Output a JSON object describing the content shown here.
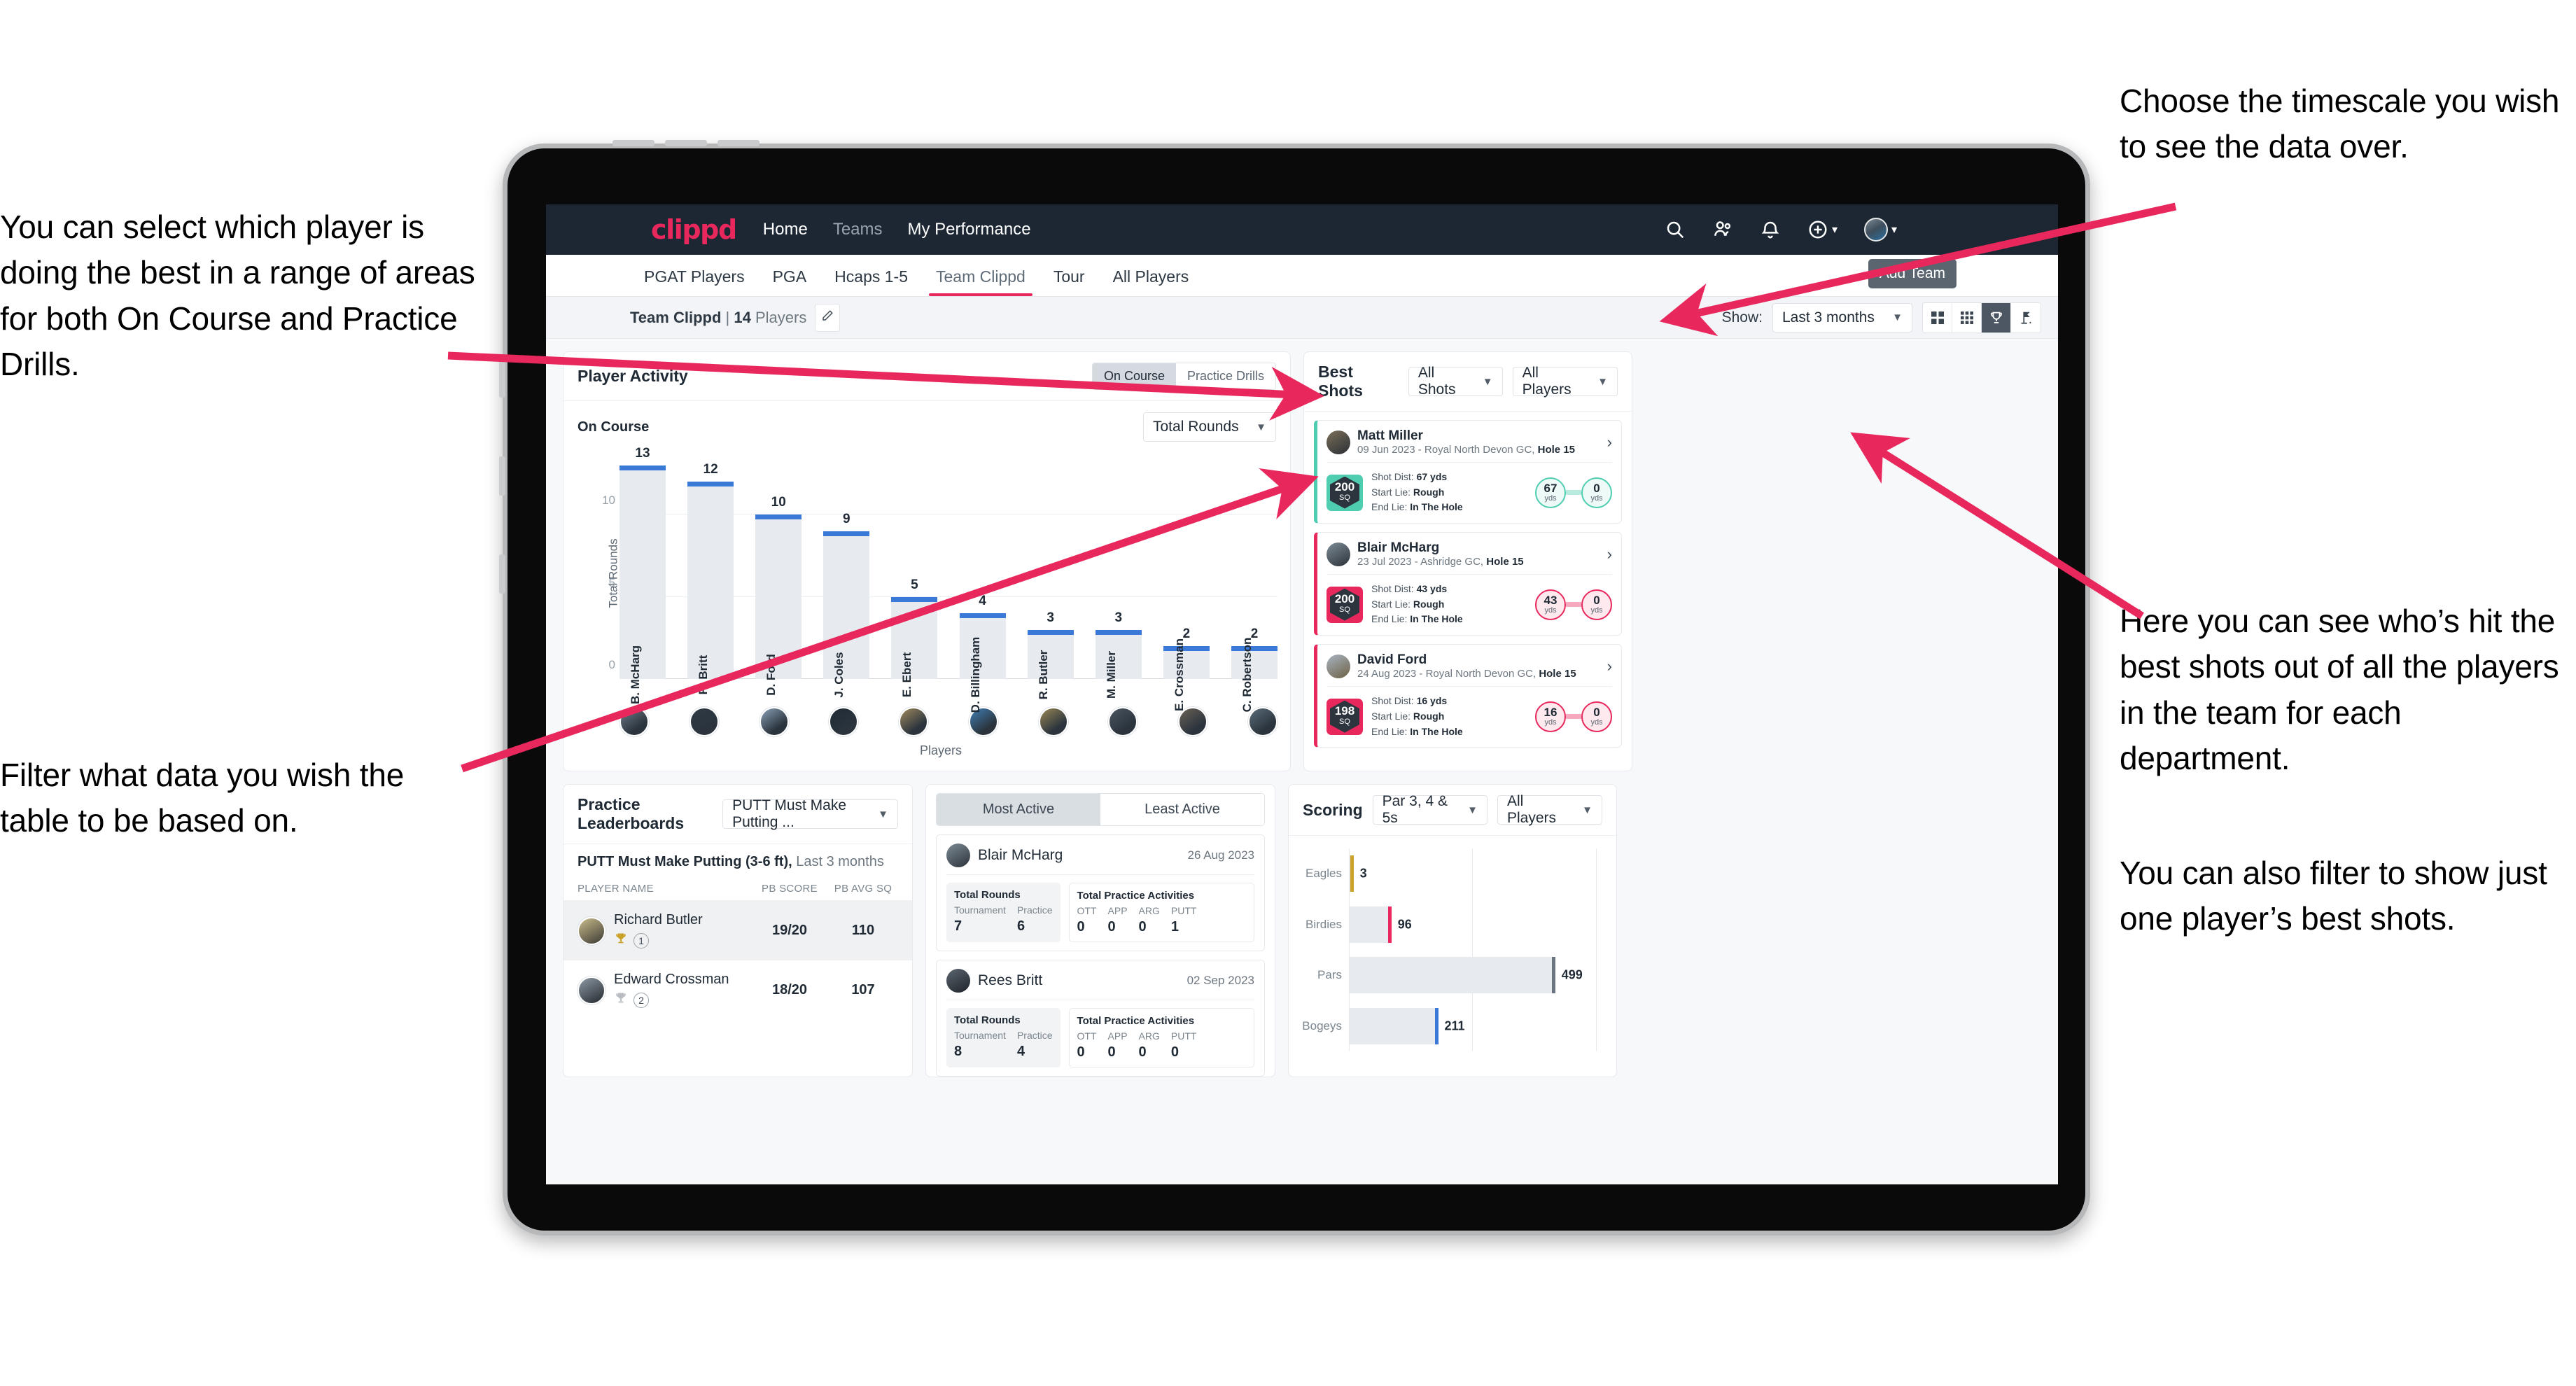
{
  "annotations": {
    "left_top": "You can select which player is doing the best in a range of areas for both On Course and Practice Drills.",
    "left_bottom": "Filter what data you wish the table to be based on.",
    "right_top": "Choose the timescale you wish to see the data over.",
    "right_middle": "Here you can see who’s hit the best shots out of all the players in the team for each department.",
    "right_bottom": "You can also filter to show just one player’s best shots."
  },
  "topnav": {
    "brand": "clippd",
    "links": [
      {
        "label": "Home",
        "dim": false
      },
      {
        "label": "Teams",
        "dim": true
      },
      {
        "label": "My Performance",
        "dim": false
      }
    ],
    "icons": [
      "search-icon",
      "people-icon",
      "bell-icon",
      "plus-circle-icon",
      "avatar"
    ]
  },
  "tabs": [
    {
      "label": "PGAT Players",
      "active": false
    },
    {
      "label": "PGA",
      "active": false
    },
    {
      "label": "Hcaps 1-5",
      "active": false
    },
    {
      "label": "Team Clippd",
      "active": true
    },
    {
      "label": "Tour",
      "active": false
    },
    {
      "label": "All Players",
      "active": false
    }
  ],
  "tooltip": "Add Team",
  "subbar": {
    "team_name": "Team Clippd",
    "separator": "|",
    "player_count": "14",
    "players_word": "Players",
    "edit_icon": "pencil-icon",
    "show_label": "Show:",
    "timescale_value": "Last 3 months",
    "view_toggles": [
      "grid-2x2-icon",
      "grid-3x3-icon",
      "trophy-icon",
      "golf-flag-icon"
    ],
    "active_view": "trophy-icon"
  },
  "player_activity": {
    "title": "Player Activity",
    "segments": [
      {
        "label": "On Course",
        "active": true
      },
      {
        "label": "Practice Drills",
        "active": false
      }
    ],
    "sub_label": "On Course",
    "metric_select": "Total Rounds",
    "x_axis_label": "Players"
  },
  "best_shots": {
    "title": "Best Shots",
    "filter_shots": "All Shots",
    "filter_players": "All Players",
    "shots": [
      {
        "player": "Matt Miller",
        "meta_date": "09 Jun 2023 - Royal North Devon GC,",
        "meta_hole": "Hole 15",
        "sq": "200",
        "sq_unit": "SQ",
        "shot_dist_label": "Shot Dist:",
        "shot_dist": "67 yds",
        "start_lie_label": "Start Lie:",
        "start_lie": "Rough",
        "end_lie_label": "End Lie:",
        "end_lie": "In The Hole",
        "from_value": "67",
        "from_unit": "yds",
        "to_value": "0",
        "to_unit": "yds",
        "accent": "#4ecdb0"
      },
      {
        "player": "Blair McHarg",
        "meta_date": "23 Jul 2023 - Ashridge GC,",
        "meta_hole": "Hole 15",
        "sq": "200",
        "sq_unit": "SQ",
        "shot_dist_label": "Shot Dist:",
        "shot_dist": "43 yds",
        "start_lie_label": "Start Lie:",
        "start_lie": "Rough",
        "end_lie_label": "End Lie:",
        "end_lie": "In The Hole",
        "from_value": "43",
        "from_unit": "yds",
        "to_value": "0",
        "to_unit": "yds",
        "accent": "#e8285d"
      },
      {
        "player": "David Ford",
        "meta_date": "24 Aug 2023 - Royal North Devon GC,",
        "meta_hole": "Hole 15",
        "sq": "198",
        "sq_unit": "SQ",
        "shot_dist_label": "Shot Dist:",
        "shot_dist": "16 yds",
        "start_lie_label": "Start Lie:",
        "start_lie": "Rough",
        "end_lie_label": "End Lie:",
        "end_lie": "In The Hole",
        "from_value": "16",
        "from_unit": "yds",
        "to_value": "0",
        "to_unit": "yds",
        "accent": "#e8285d"
      }
    ]
  },
  "practice_leaderboards": {
    "title": "Practice Leaderboards",
    "drill_select": "PUTT Must Make Putting ...",
    "sub_title": "PUTT Must Make Putting (3-6 ft),",
    "sub_period": "Last 3 months",
    "columns": [
      "PLAYER NAME",
      "PB SCORE",
      "PB AVG SQ"
    ],
    "rows": [
      {
        "name": "Richard Butler",
        "rank": "1",
        "trophy": "gold",
        "pb_score": "19/20",
        "pb_avg_sq": "110",
        "highlight": true
      },
      {
        "name": "Edward Crossman",
        "rank": "2",
        "trophy": "silver",
        "pb_score": "18/20",
        "pb_avg_sq": "107",
        "highlight": false
      }
    ]
  },
  "activity": {
    "tabs": [
      {
        "label": "Most Active",
        "active": true
      },
      {
        "label": "Least Active",
        "active": false
      }
    ],
    "cards": [
      {
        "player": "Blair McHarg",
        "date": "26 Aug 2023",
        "rounds_title": "Total Rounds",
        "rounds": [
          {
            "key": "Tournament",
            "value": "7"
          },
          {
            "key": "Practice",
            "value": "6"
          }
        ],
        "practice_title": "Total Practice Activities",
        "practice": [
          {
            "key": "OTT",
            "value": "0"
          },
          {
            "key": "APP",
            "value": "0"
          },
          {
            "key": "ARG",
            "value": "0"
          },
          {
            "key": "PUTT",
            "value": "1"
          }
        ]
      },
      {
        "player": "Rees Britt",
        "date": "02 Sep 2023",
        "rounds_title": "Total Rounds",
        "rounds": [
          {
            "key": "Tournament",
            "value": "8"
          },
          {
            "key": "Practice",
            "value": "4"
          }
        ],
        "practice_title": "Total Practice Activities",
        "practice": [
          {
            "key": "OTT",
            "value": "0"
          },
          {
            "key": "APP",
            "value": "0"
          },
          {
            "key": "ARG",
            "value": "0"
          },
          {
            "key": "PUTT",
            "value": "0"
          }
        ]
      }
    ]
  },
  "scoring": {
    "title": "Scoring",
    "filter_par": "Par 3, 4 & 5s",
    "filter_players": "All Players"
  },
  "colors": {
    "brand_pink": "#e8285d",
    "nav_dark": "#1c2733",
    "bar_blue": "#3b79d8",
    "teal": "#4ecdb0",
    "gold": "#c9a227"
  },
  "chart_data": [
    {
      "type": "bar",
      "title": "Player Activity — On Course",
      "categories": [
        "B. McHarg",
        "R. Britt",
        "D. Ford",
        "J. Coles",
        "E. Ebert",
        "D. Billingham",
        "R. Butler",
        "M. Miller",
        "E. Crossman",
        "C. Robertson"
      ],
      "values": [
        13,
        12,
        10,
        9,
        5,
        4,
        3,
        3,
        2,
        2
      ],
      "xlabel": "Players",
      "ylabel": "Total Rounds",
      "yticks": [
        0,
        5,
        10
      ],
      "ylim": [
        0,
        14
      ],
      "grid": true,
      "legend": "none"
    },
    {
      "type": "bar",
      "orientation": "horizontal",
      "title": "Scoring",
      "categories": [
        "Eagles",
        "Birdies",
        "Pars",
        "Bogeys"
      ],
      "values": [
        3,
        96,
        499,
        211
      ],
      "colors": [
        "#c9a227",
        "#e8285d",
        "#6b757f",
        "#3b79d8"
      ],
      "xlabel": "",
      "ylabel": "",
      "xlim": [
        0,
        620
      ],
      "grid": true,
      "legend": "none"
    }
  ]
}
